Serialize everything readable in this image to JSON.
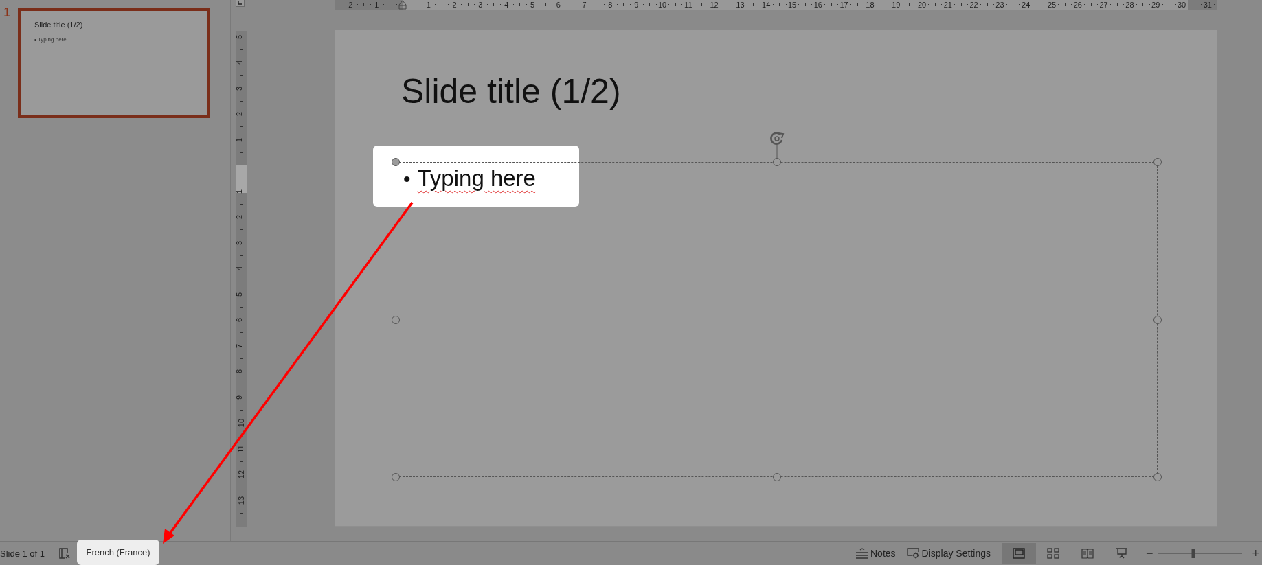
{
  "slide_panel": {
    "slides": [
      {
        "number": "1",
        "selected": true,
        "title": "Slide title (1/2)",
        "bullet": "•",
        "text": "Typing here"
      }
    ]
  },
  "top_ruler": {
    "negative": [
      "2",
      "1"
    ],
    "positive": [
      "1",
      "2",
      "3",
      "4",
      "5",
      "6",
      "7",
      "8",
      "9",
      "10",
      "11",
      "12",
      "13",
      "14",
      "15",
      "16",
      "17",
      "18",
      "19",
      "20",
      "21",
      "22",
      "23",
      "24",
      "25",
      "26",
      "27",
      "28",
      "29",
      "30",
      "31"
    ]
  },
  "left_ruler": {
    "above": [
      "5",
      "4",
      "3",
      "2",
      "1"
    ],
    "below": [
      "1",
      "2",
      "3",
      "4",
      "5",
      "6",
      "7",
      "8",
      "9",
      "10",
      "11",
      "12",
      "13"
    ]
  },
  "slide": {
    "title": "Slide title (1/2)",
    "placeholder": {
      "selected": true,
      "bullets": [
        {
          "bullet": "•",
          "text": "Typing here",
          "misspelled": true,
          "highlighted": true
        }
      ]
    }
  },
  "status_bar": {
    "slide_counter": "Slide 1 of 1",
    "language": {
      "label": "French (France)",
      "highlighted": true
    },
    "notes": "Notes",
    "display_settings": "Display Settings",
    "views": [
      {
        "kind": "normal",
        "selected": true
      },
      {
        "kind": "sorter",
        "selected": false
      },
      {
        "kind": "reading",
        "selected": false
      },
      {
        "kind": "slideshow",
        "selected": false
      }
    ],
    "zoom": {
      "minus": "−",
      "plus": "+",
      "level": 0.41
    }
  }
}
